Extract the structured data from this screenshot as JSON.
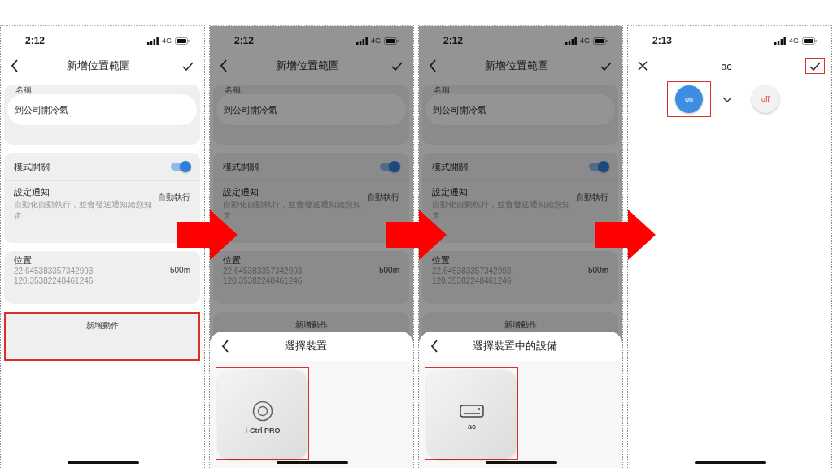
{
  "panels": [
    {
      "kind": "form",
      "status": {
        "time": "2:12",
        "network": "4G"
      },
      "header": {
        "title": "新增位置範圍"
      },
      "name_field": {
        "label": "名稱",
        "value": "到公司開冷氣"
      },
      "mode_switch": {
        "label": "模式開關",
        "on": true
      },
      "notification": {
        "title": "設定通知",
        "description": "自動化自動執行，並會發送通知給您知道",
        "value": "自動執行"
      },
      "location": {
        "title": "位置",
        "coordinates": "22.645383357342993, 120.35382248461246",
        "radius": "500m"
      },
      "add_action": {
        "label": "新增動作",
        "highlighted": true
      }
    },
    {
      "kind": "form",
      "dimmed": true,
      "status": {
        "time": "2:12",
        "network": "4G"
      },
      "header": {
        "title": "新增位置範圍"
      },
      "name_field": {
        "label": "名稱",
        "value": "到公司開冷氣"
      },
      "mode_switch": {
        "label": "模式開關",
        "on": true
      },
      "notification": {
        "title": "設定通知",
        "description": "自動化自動執行，並會發送通知給您知道",
        "value": "自動執行"
      },
      "location": {
        "title": "位置",
        "coordinates": "22.645383357342993, 120.35382248461246",
        "radius": "500m"
      },
      "add_action": {
        "label": "新增動作",
        "highlighted": false
      },
      "sheet": {
        "title": "選擇裝置",
        "items": [
          {
            "kind": "device",
            "label": "i-Ctrl PRO",
            "highlighted": true
          }
        ]
      }
    },
    {
      "kind": "form",
      "dimmed": true,
      "status": {
        "time": "2:12",
        "network": "4G"
      },
      "header": {
        "title": "新增位置範圍"
      },
      "name_field": {
        "label": "名稱",
        "value": "到公司開冷氣"
      },
      "mode_switch": {
        "label": "模式開關",
        "on": true
      },
      "notification": {
        "title": "設定通知",
        "description": "自動化自動執行，並會發送通知給您知道",
        "value": "自動執行"
      },
      "location": {
        "title": "位置",
        "coordinates": "22.645383357342993, 120.35382248461246",
        "radius": "500m"
      },
      "add_action": {
        "label": "新增動作",
        "highlighted": false
      },
      "sheet": {
        "title": "選擇裝置中的設備",
        "items": [
          {
            "kind": "ac",
            "label": "ac",
            "highlighted": true
          }
        ]
      }
    },
    {
      "kind": "action",
      "status": {
        "time": "2:13",
        "network": "4G"
      },
      "header": {
        "title": "ac",
        "confirm_highlighted": true
      },
      "options": [
        {
          "label": "on",
          "selected": true,
          "highlighted": true
        },
        {
          "label": "off",
          "selected": false,
          "highlighted": false
        }
      ]
    }
  ]
}
